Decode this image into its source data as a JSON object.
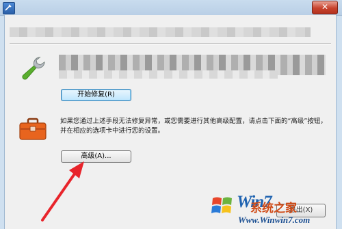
{
  "window": {
    "close_label": "✕"
  },
  "repair": {
    "button_label": "开始修复(R)"
  },
  "advanced": {
    "description": "如果您通过上述手段无法修复异常，或您需要进行其他高级配置，请点击下面的“高级”按钮，并在相应的选项卡中进行您的设置。",
    "button_label": "高级(A)..."
  },
  "footer": {
    "exit_label": "退出(X)"
  },
  "watermark": {
    "brand": "Win7",
    "site_name": "系统之家",
    "url": "Www.Winwin7.com"
  },
  "colors": {
    "arrow": "#e8242b",
    "wrench_green": "#5aae2e",
    "toolbox_orange": "#e8641e"
  }
}
